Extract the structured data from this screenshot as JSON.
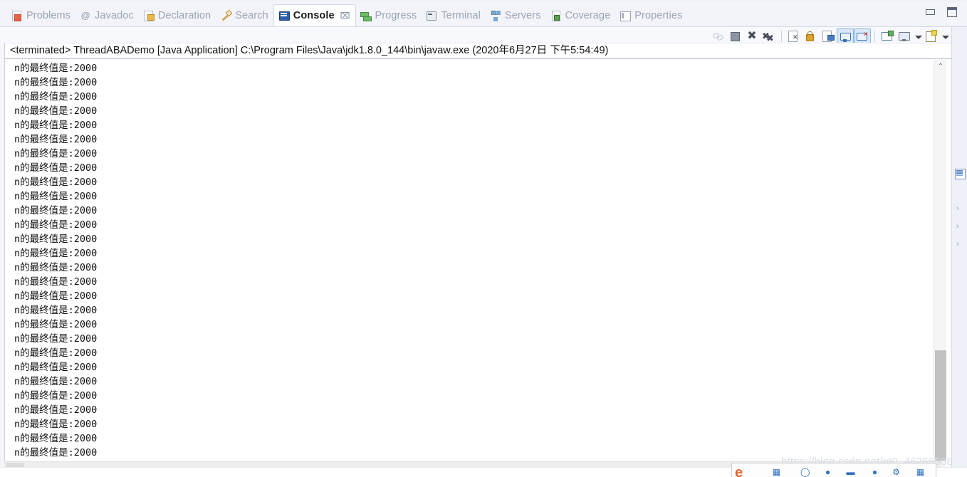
{
  "window": {
    "minimize_label": "minimize",
    "maximize_label": "maximize"
  },
  "tabs": [
    {
      "label": "Problems",
      "icon": "problems-icon",
      "active": false
    },
    {
      "label": "Javadoc",
      "icon": "javadoc-icon",
      "active": false
    },
    {
      "label": "Declaration",
      "icon": "declaration-icon",
      "active": false
    },
    {
      "label": "Search",
      "icon": "search-icon",
      "active": false
    },
    {
      "label": "Console",
      "icon": "console-icon",
      "active": true,
      "close": "⌧"
    },
    {
      "label": "Progress",
      "icon": "progress-icon",
      "active": false
    },
    {
      "label": "Terminal",
      "icon": "terminal-icon",
      "active": false
    },
    {
      "label": "Servers",
      "icon": "servers-icon",
      "active": false
    },
    {
      "label": "Coverage",
      "icon": "coverage-icon",
      "active": false
    },
    {
      "label": "Properties",
      "icon": "properties-icon",
      "active": false
    }
  ],
  "toolbar": {
    "buttons": [
      {
        "name": "terminate-all-icon",
        "glyph": "g-link",
        "toggled": false
      },
      {
        "name": "terminate-icon",
        "glyph": "g-stop",
        "toggled": false
      },
      {
        "name": "remove-launch-icon",
        "glyph": "g-x",
        "toggled": false
      },
      {
        "name": "remove-all-terminated-icon",
        "glyph": "g-xx",
        "toggled": false
      },
      {
        "name": "clear-console-icon",
        "glyph": "g-docx",
        "toggled": false
      },
      {
        "name": "scroll-lock-icon",
        "glyph": "g-lock",
        "toggled": false
      },
      {
        "name": "word-wrap-icon",
        "glyph": "g-docin",
        "toggled": false
      },
      {
        "name": "show-console-on-output-icon",
        "glyph": "g-screen",
        "toggled": true
      },
      {
        "name": "show-console-on-error-icon",
        "glyph": "g-screenx",
        "toggled": true
      },
      {
        "name": "pin-console-icon",
        "glyph": "g-newcon",
        "toggled": false
      },
      {
        "name": "display-selected-console-icon",
        "glyph": "g-mon",
        "toggled": false
      },
      {
        "name": "open-console-icon",
        "glyph": "g-newpg",
        "toggled": false
      }
    ]
  },
  "console": {
    "header": "<terminated> ThreadABADemo [Java Application] C:\\Program Files\\Java\\jdk1.8.0_144\\bin\\javaw.exe (2020年6月27日 下午5:54:49)",
    "line_text": "n的最终值是:2000",
    "line_count": 28,
    "scroll": {
      "up_arrow": "⌃",
      "down_arrow": "⌄"
    }
  },
  "right_stack": {
    "icons": [
      "outline-view-icon",
      "restore-chevron-icon",
      "restore-chevron-icon",
      "restore-chevron-icon"
    ],
    "chevron": "›"
  },
  "watermark": {
    "text": "https://blog.csdn.net/m0_46266508"
  },
  "taskbar": {
    "browser_icon": "edge-icon",
    "items": [
      "folder-icon",
      "circle-icon",
      "person-icon",
      "window-icon",
      "dot-icon",
      "settings-icon",
      "grid-icon"
    ]
  },
  "colors": {
    "accent": "#2d5ea8",
    "tab_inactive_text": "#9aa3b5",
    "console_text": "#111111",
    "watermark": "#d8dde6",
    "toggled_bg": "#d7e7f7"
  }
}
